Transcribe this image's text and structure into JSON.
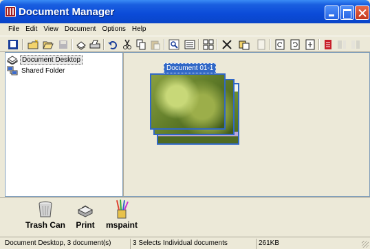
{
  "window": {
    "title": "Document Manager"
  },
  "menu": [
    "File",
    "Edit",
    "View",
    "Document",
    "Options",
    "Help"
  ],
  "toolbar_icons": [
    "new-document-icon",
    "new-folder-icon",
    "open-folder-icon",
    "save-icon",
    "scan-icon",
    "print-icon",
    "undo-icon",
    "cut-icon",
    "copy-icon",
    "paste-icon",
    "find-icon",
    "view-details-icon",
    "view-thumbnails-icon",
    "delete-icon",
    "duplicate-icon",
    "blank-page-icon",
    "rotate-left-icon",
    "rotate-right-icon",
    "flip-icon",
    "stack-icon",
    "unstack-icon",
    "split-icon"
  ],
  "tree": [
    {
      "label": "Document Desktop",
      "icon": "desktop-tray-icon",
      "selected": true
    },
    {
      "label": "Shared Folder",
      "icon": "shared-folder-icon",
      "selected": false
    }
  ],
  "document": {
    "label": "Document 01-1"
  },
  "shelf": [
    {
      "label": "Trash Can",
      "icon": "trash-can-icon"
    },
    {
      "label": "Print",
      "icon": "printer-icon"
    },
    {
      "label": "mspaint",
      "icon": "paint-brushes-icon"
    }
  ],
  "status": {
    "location": "Document Desktop, 3 document(s)",
    "selection": "3 Selects Individual documents",
    "size": "261KB"
  },
  "colors": {
    "titlebar": "#0a45c8",
    "selection": "#3168c6",
    "close": "#c4371d",
    "face": "#ece9d8"
  }
}
